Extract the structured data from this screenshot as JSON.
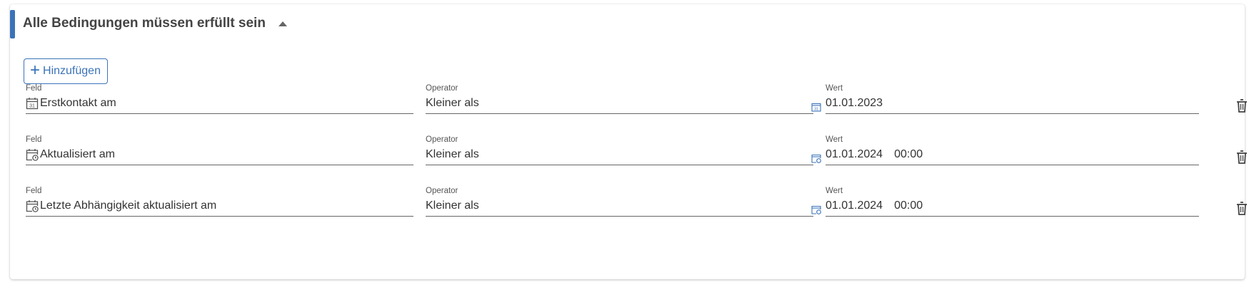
{
  "group": {
    "title": "Alle Bedingungen müssen erfüllt sein",
    "add_label": "Hinzufügen"
  },
  "labels": {
    "field": "Feld",
    "operator": "Operator",
    "value": "Wert"
  },
  "conditions": [
    {
      "field": "Erstkontakt am",
      "field_icon": "calendar-icon",
      "operator": "Kleiner als",
      "date": "01.01.2023",
      "time": "",
      "value_icon": "calendar-icon"
    },
    {
      "field": "Aktualisiert am",
      "field_icon": "calendar-clock-icon",
      "operator": "Kleiner als",
      "date": "01.01.2024",
      "time": "00:00",
      "value_icon": "calendar-clock-icon"
    },
    {
      "field": "Letzte Abhängigkeit aktualisiert am",
      "field_icon": "calendar-clock-icon",
      "operator": "Kleiner als",
      "date": "01.01.2024",
      "time": "00:00",
      "value_icon": "calendar-clock-icon"
    }
  ],
  "colors": {
    "accent": "#3b73b9",
    "text": "#333333",
    "underline": "#666666"
  }
}
